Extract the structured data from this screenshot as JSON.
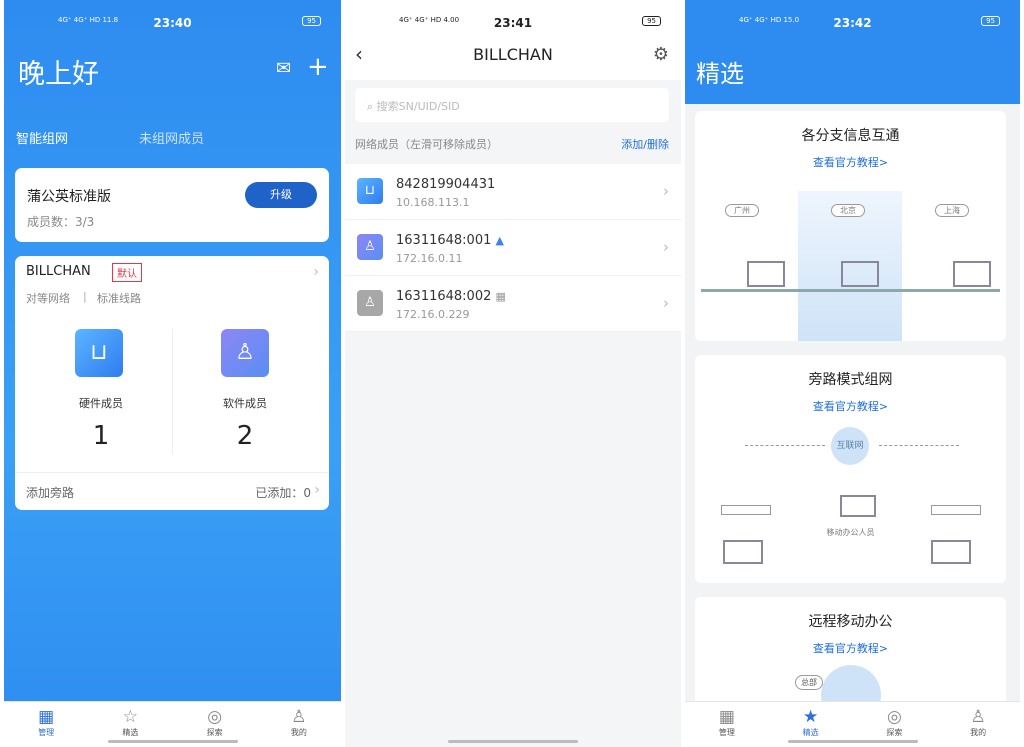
{
  "screen1": {
    "status": {
      "signal": "4G⁺ 4G⁺ HD 11.8",
      "time": "23:40",
      "battery": "95"
    },
    "greeting": "晚上好",
    "tabs": [
      "智能组网",
      "未组网成员"
    ],
    "plan_card": {
      "name": "蒲公英标准版",
      "members": "成员数：3/3",
      "upgrade": "升级"
    },
    "network_card": {
      "name": "BILLCHAN",
      "badge": "默认",
      "type": "对等网络",
      "sep": "|",
      "line": "标准线路",
      "hardware_label": "硬件成员",
      "hardware_count": "1",
      "software_label": "软件成员",
      "software_count": "2",
      "bypass_label": "添加旁路",
      "bypass_added": "已添加：0"
    },
    "nav": [
      "管理",
      "精选",
      "探索",
      "我的"
    ]
  },
  "screen2": {
    "status": {
      "signal": "4G⁺ 4G⁺ HD 4.00",
      "time": "23:41",
      "battery": "95"
    },
    "title": "BILLCHAN",
    "search_placeholder": "搜索SN/UID/SID",
    "section_label": "网络成员（左滑可移除成员）",
    "section_action": "添加/删除",
    "members": [
      {
        "name": "842819904431",
        "ip": "10.168.113.1",
        "os": ""
      },
      {
        "name": "16311648:001",
        "ip": "172.16.0.11",
        "os": "android"
      },
      {
        "name": "16311648:002",
        "ip": "172.16.0.229",
        "os": "windows"
      }
    ],
    "colors": {
      "accent": "#1e6fd9",
      "hardware": "#3a8ff0",
      "android": "#7d7af0",
      "windows": "#a7a7a7"
    }
  },
  "screen3": {
    "status": {
      "signal": "4G⁺ 4G⁺ HD 15.0",
      "time": "23:42",
      "battery": "95"
    },
    "title": "精选",
    "features": [
      {
        "title": "各分支信息互通",
        "link": "查看官方教程>",
        "cities": [
          "广州",
          "北京",
          "上海"
        ]
      },
      {
        "title": "旁路模式组网",
        "link": "查看官方教程>",
        "internet": "互联网",
        "mobile": "移动办公人员"
      },
      {
        "title": "远程移动办公",
        "link": "查看官方教程>",
        "hq": "总部"
      }
    ],
    "nav": [
      "管理",
      "精选",
      "探索",
      "我的"
    ]
  }
}
